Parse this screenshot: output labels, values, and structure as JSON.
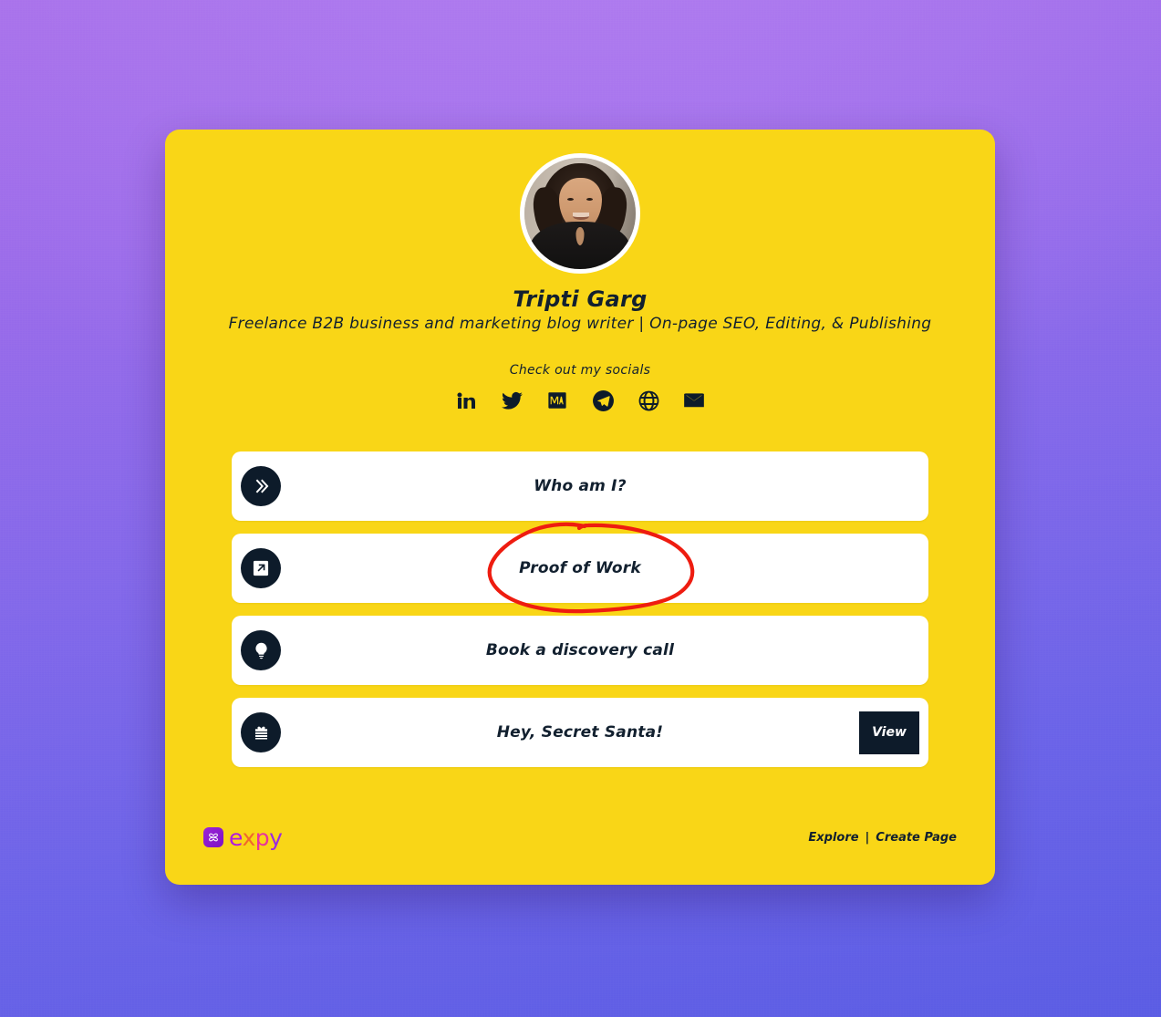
{
  "theme": {
    "card_bg": "#f9d617",
    "ink": "#0d1b2a",
    "page_gradient_top": "#a66ee9",
    "page_gradient_bottom": "#5a5ce4",
    "annotation_color": "#ee1c10"
  },
  "profile": {
    "avatar_alt": "profile-photo",
    "name": "Tripti Garg",
    "bio": "Freelance B2B business and marketing blog writer | On-page SEO, Editing, & Publishing",
    "socials_label": "Check out my socials"
  },
  "socials": [
    {
      "name": "linkedin-icon",
      "label": "LinkedIn"
    },
    {
      "name": "twitter-icon",
      "label": "Twitter"
    },
    {
      "name": "medium-icon",
      "label": "Medium"
    },
    {
      "name": "telegram-icon",
      "label": "Telegram"
    },
    {
      "name": "website-icon",
      "label": "Website"
    },
    {
      "name": "email-icon",
      "label": "Email"
    }
  ],
  "links": [
    {
      "icon": "double-chevron-right-icon",
      "label": "Who am I?",
      "cta": null
    },
    {
      "icon": "arrow-up-right-box-icon",
      "label": "Proof of Work",
      "cta": null
    },
    {
      "icon": "lightbulb-icon",
      "label": "Book a discovery call",
      "cta": null
    },
    {
      "icon": "gift-icon",
      "label": "Hey, Secret Santa!",
      "cta": "View"
    }
  ],
  "footer": {
    "brand_badge": "expy-logo-icon",
    "brand_part_1": "e",
    "brand_part_2": "x",
    "brand_part_3": "p",
    "brand_part_4": "y",
    "explore_label": "Explore",
    "separator": "|",
    "create_page_label": "Create Page"
  },
  "annotation": {
    "shape": "hand-drawn-ellipse",
    "targets": "Proof of Work"
  }
}
